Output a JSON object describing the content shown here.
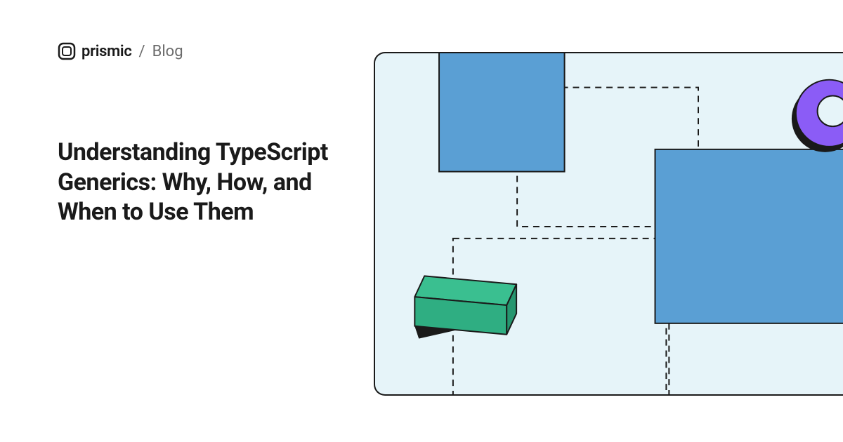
{
  "header": {
    "brand": "prismic",
    "separator": "/",
    "section": "Blog"
  },
  "title": "Understanding TypeScript Generics: Why, How, and When to Use Them",
  "illustration": {
    "colors": {
      "background": "#e6f4f9",
      "blue": "#5a9fd4",
      "green": "#3abf90",
      "greenDark": "#2a9f76",
      "purple": "#8b5cf6",
      "purpleDark": "#6b3fc9",
      "outline": "#1a1a1a"
    }
  }
}
